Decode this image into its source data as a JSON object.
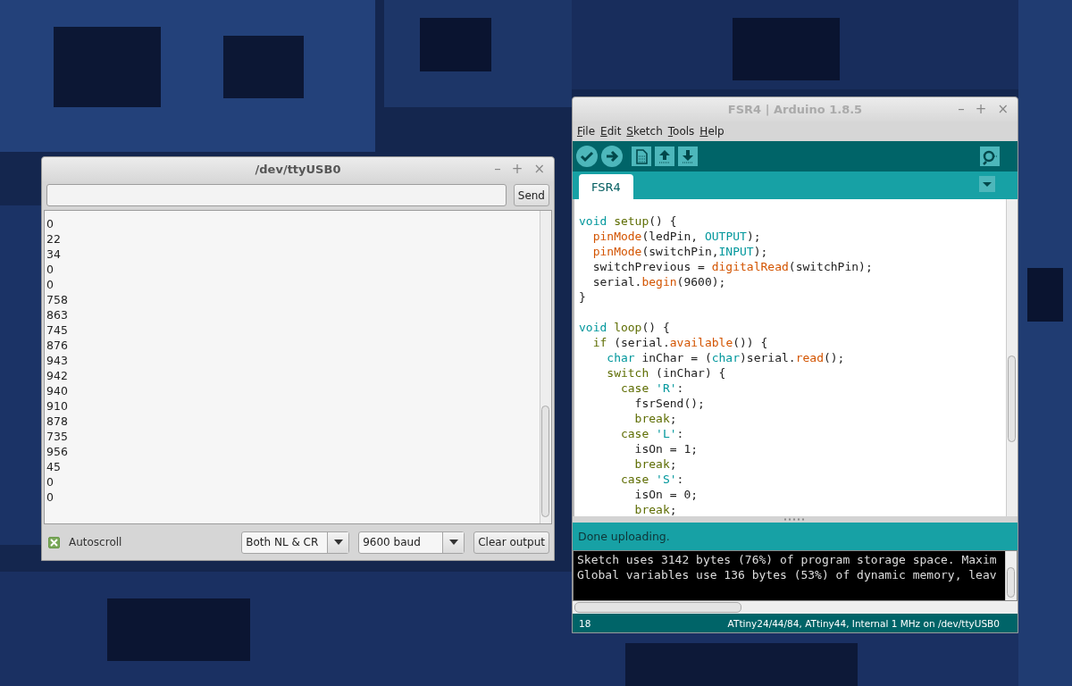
{
  "serial_monitor": {
    "title": "/dev/ttyUSB0",
    "window_controls": [
      "–",
      "+",
      "×"
    ],
    "send_button": "Send",
    "output": [
      "0",
      "22",
      "34",
      "0",
      "0",
      "758",
      "863",
      "745",
      "876",
      "943",
      "942",
      "940",
      "910",
      "878",
      "735",
      "956",
      "45",
      "0",
      "0"
    ],
    "autoscroll": {
      "label": "Autoscroll",
      "checked": true
    },
    "line_ending": "Both NL & CR",
    "baud": "9600 baud",
    "clear_button": "Clear output"
  },
  "ide": {
    "title": "FSR4 | Arduino 1.8.5",
    "window_controls": [
      "–",
      "+",
      "×"
    ],
    "menu": [
      {
        "label": "File"
      },
      {
        "label": "Edit"
      },
      {
        "label": "Sketch"
      },
      {
        "label": "Tools"
      },
      {
        "label": "Help"
      }
    ],
    "tabs": [
      {
        "label": "FSR4",
        "selected": true
      }
    ],
    "code": [
      {
        "kind": "code",
        "segments": [
          {
            "text": "void ",
            "kind": "type"
          },
          {
            "text": "setup",
            "kind": "keyword"
          },
          {
            "text": "() {",
            "kind": "plain"
          }
        ]
      },
      {
        "kind": "code",
        "segments": [
          {
            "text": "  pinMode",
            "kind": "function"
          },
          {
            "text": "(ledPin, ",
            "kind": "plain"
          },
          {
            "text": "OUTPUT",
            "kind": "constant"
          },
          {
            "text": ");",
            "kind": "plain"
          }
        ]
      },
      {
        "kind": "code",
        "segments": [
          {
            "text": "  pinMode",
            "kind": "function"
          },
          {
            "text": "(switchPin,",
            "kind": "plain"
          },
          {
            "text": "INPUT",
            "kind": "constant"
          },
          {
            "text": ");",
            "kind": "plain"
          }
        ]
      },
      {
        "kind": "code",
        "segments": [
          {
            "text": "  switchPrevious = ",
            "kind": "plain"
          },
          {
            "text": "digitalRead",
            "kind": "function"
          },
          {
            "text": "(switchPin);",
            "kind": "plain"
          }
        ]
      },
      {
        "kind": "code",
        "segments": [
          {
            "text": "  serial.",
            "kind": "plain"
          },
          {
            "text": "begin",
            "kind": "function"
          },
          {
            "text": "(9600);",
            "kind": "plain"
          }
        ]
      },
      {
        "kind": "code",
        "segments": [
          {
            "text": "}",
            "kind": "plain"
          }
        ]
      },
      {
        "kind": "blank"
      },
      {
        "kind": "code",
        "segments": [
          {
            "text": "void ",
            "kind": "type"
          },
          {
            "text": "loop",
            "kind": "keyword"
          },
          {
            "text": "() {",
            "kind": "plain"
          }
        ]
      },
      {
        "kind": "code",
        "segments": [
          {
            "text": "  if",
            "kind": "keyword"
          },
          {
            "text": " (serial.",
            "kind": "plain"
          },
          {
            "text": "available",
            "kind": "function"
          },
          {
            "text": "()) {",
            "kind": "plain"
          }
        ]
      },
      {
        "kind": "code",
        "segments": [
          {
            "text": "    char",
            "kind": "type"
          },
          {
            "text": " inChar = (",
            "kind": "plain"
          },
          {
            "text": "char",
            "kind": "type"
          },
          {
            "text": ")serial.",
            "kind": "plain"
          },
          {
            "text": "read",
            "kind": "function"
          },
          {
            "text": "();",
            "kind": "plain"
          }
        ]
      },
      {
        "kind": "code",
        "segments": [
          {
            "text": "    switch",
            "kind": "keyword"
          },
          {
            "text": " (inChar) {",
            "kind": "plain"
          }
        ]
      },
      {
        "kind": "code",
        "segments": [
          {
            "text": "      case ",
            "kind": "keyword"
          },
          {
            "text": "'R'",
            "kind": "constant"
          },
          {
            "text": ":",
            "kind": "plain"
          }
        ]
      },
      {
        "kind": "code",
        "segments": [
          {
            "text": "        fsrSend();",
            "kind": "plain"
          }
        ]
      },
      {
        "kind": "code",
        "segments": [
          {
            "text": "        break",
            "kind": "keyword"
          },
          {
            "text": ";",
            "kind": "plain"
          }
        ]
      },
      {
        "kind": "code",
        "segments": [
          {
            "text": "      case ",
            "kind": "keyword"
          },
          {
            "text": "'L'",
            "kind": "constant"
          },
          {
            "text": ":",
            "kind": "plain"
          }
        ]
      },
      {
        "kind": "code",
        "segments": [
          {
            "text": "        isOn = 1;",
            "kind": "plain"
          }
        ]
      },
      {
        "kind": "code",
        "segments": [
          {
            "text": "        break",
            "kind": "keyword"
          },
          {
            "text": ";",
            "kind": "plain"
          }
        ]
      },
      {
        "kind": "code",
        "segments": [
          {
            "text": "      case ",
            "kind": "keyword"
          },
          {
            "text": "'S'",
            "kind": "constant"
          },
          {
            "text": ":",
            "kind": "plain"
          }
        ]
      },
      {
        "kind": "code",
        "segments": [
          {
            "text": "        isOn = 0;",
            "kind": "plain"
          }
        ]
      },
      {
        "kind": "code",
        "segments": [
          {
            "text": "        break",
            "kind": "keyword"
          },
          {
            "text": ";",
            "kind": "plain"
          }
        ]
      }
    ],
    "status": "Done uploading.",
    "console": [
      "Sketch uses 3142 bytes (76%) of program storage space. Maxim",
      "Global variables use 136 bytes (53%) of dynamic memory, leav"
    ],
    "footer": {
      "line": "18",
      "board": "ATtiny24/44/84, ATtiny44, Internal 1 MHz on /dev/ttyUSB0"
    }
  }
}
